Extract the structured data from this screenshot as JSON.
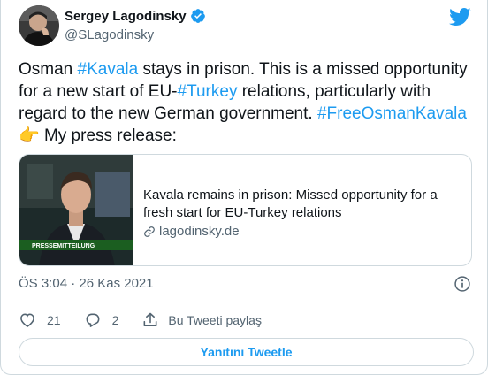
{
  "author": {
    "name": "Sergey Lagodinsky",
    "handle": "@SLagodinsky"
  },
  "tweet": {
    "t1": "Osman ",
    "h1": "#Kavala",
    "t2": " stays in prison. This is a missed opportunity for a new start of EU-",
    "h2": "#Turkey",
    "t3": " relations, particularly with regard to the new German government. ",
    "h3": "#FreeOsmanKavala",
    "emoji": "👉",
    "t4": " My press release:"
  },
  "link_card": {
    "title": "Kavala remains in prison: Missed opportunity for a fresh start for EU-Turkey relations",
    "domain": "lagodinsky.de",
    "thumb_banner": "PRESSEMITTEILUNG"
  },
  "meta": {
    "timestamp": "ÖS 3:04 · 26 Kas 2021"
  },
  "actions": {
    "likes": "21",
    "replies": "2",
    "share_label": "Bu Tweeti paylaş"
  },
  "reply_button": {
    "label": "Yanıtını Tweetle"
  },
  "colors": {
    "accent": "#1d9bf0",
    "text": "#0f1419",
    "muted": "#536471",
    "border": "#cfd9de"
  },
  "icons": [
    "verified-badge-icon",
    "twitter-logo-icon",
    "link-icon",
    "info-icon",
    "heart-icon",
    "reply-icon",
    "share-icon"
  ]
}
